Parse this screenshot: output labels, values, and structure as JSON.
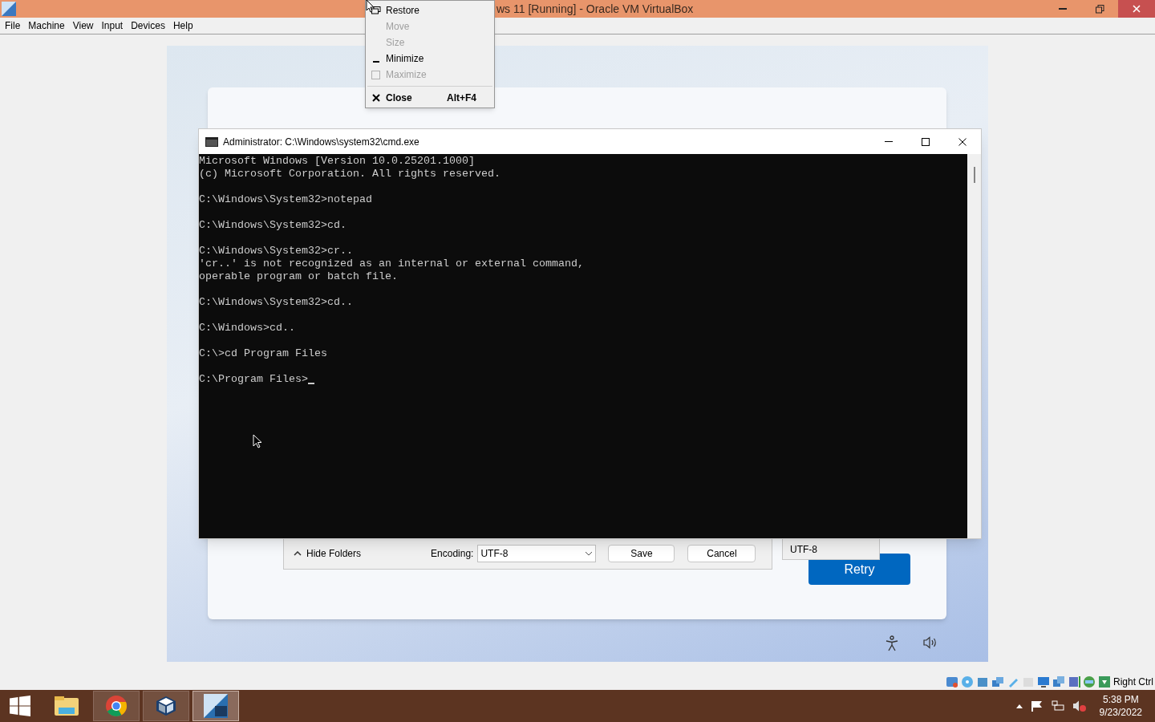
{
  "host_window": {
    "title": "ws 11 [Running] - Oracle VM VirtualBox"
  },
  "menu_bar": [
    "File",
    "Machine",
    "View",
    "Input",
    "Devices",
    "Help"
  ],
  "system_menu": [
    {
      "kind": "restore",
      "label": "Restore",
      "disabled": false,
      "default": false
    },
    {
      "kind": "plain",
      "label": "Move",
      "disabled": true,
      "default": false
    },
    {
      "kind": "plain",
      "label": "Size",
      "disabled": true,
      "default": false
    },
    {
      "kind": "minimize",
      "label": "Minimize",
      "disabled": false,
      "default": false
    },
    {
      "kind": "maximize",
      "label": "Maximize",
      "disabled": true,
      "default": false
    },
    {
      "kind": "close",
      "label": "Close",
      "shortcut": "Alt+F4",
      "disabled": false,
      "default": true
    }
  ],
  "cmd_window": {
    "title": "Administrator: C:\\Windows\\system32\\cmd.exe",
    "blocks": [
      [
        "Microsoft Windows [Version 10.0.25201.1000]",
        "(c) Microsoft Corporation. All rights reserved."
      ],
      [
        "C:\\Windows\\System32>notepad"
      ],
      [
        "C:\\Windows\\System32>cd."
      ],
      [
        "C:\\Windows\\System32>cr..",
        "'cr..' is not recognized as an internal or external command,",
        "operable program or batch file."
      ],
      [
        "C:\\Windows\\System32>cd.."
      ],
      [
        "C:\\Windows>cd.."
      ],
      [
        "C:\\>cd Program Files"
      ],
      [
        "C:\\Program Files>"
      ]
    ]
  },
  "save_dialog": {
    "hide_folders": "Hide Folders",
    "encoding_label": "Encoding:",
    "encoding_value": "UTF-8",
    "save": "Save",
    "cancel": "Cancel"
  },
  "encoding_fragment": "UTF-8",
  "retry_button": "Retry",
  "status_bar": {
    "host_key": "Right Ctrl"
  },
  "taskbar": {
    "apps": [
      {
        "kind": "explorer",
        "selected": false
      },
      {
        "kind": "chrome",
        "selected": false
      },
      {
        "kind": "virtualbox",
        "selected": false
      },
      {
        "kind": "vm",
        "selected": true
      }
    ],
    "time": "5:38 PM",
    "date": "9/23/2022"
  }
}
